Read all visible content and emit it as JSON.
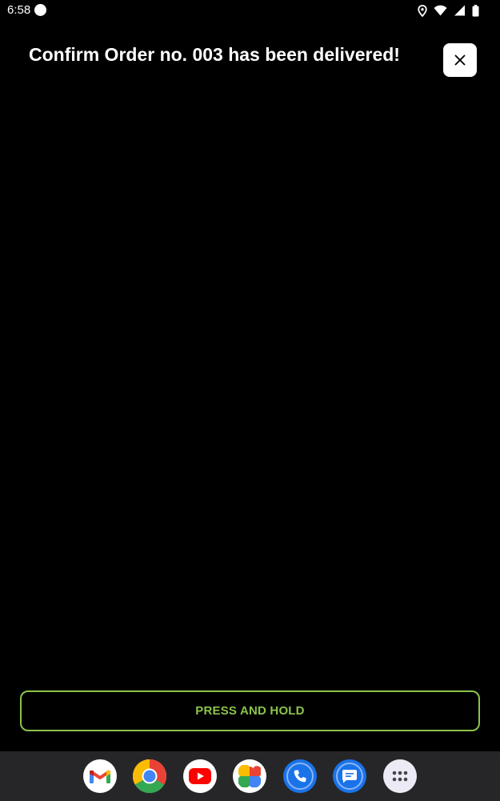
{
  "status_bar": {
    "time": "6:58"
  },
  "dialog": {
    "title": "Confirm Order no. 003 has been delivered!",
    "close_icon": "close-icon"
  },
  "action": {
    "label": "PRESS AND HOLD",
    "accent_color": "#8bc34a"
  },
  "dock": {
    "apps": [
      "gmail-icon",
      "chrome-icon",
      "youtube-icon",
      "photos-icon",
      "phone-icon",
      "messages-icon",
      "app-drawer-icon"
    ]
  }
}
